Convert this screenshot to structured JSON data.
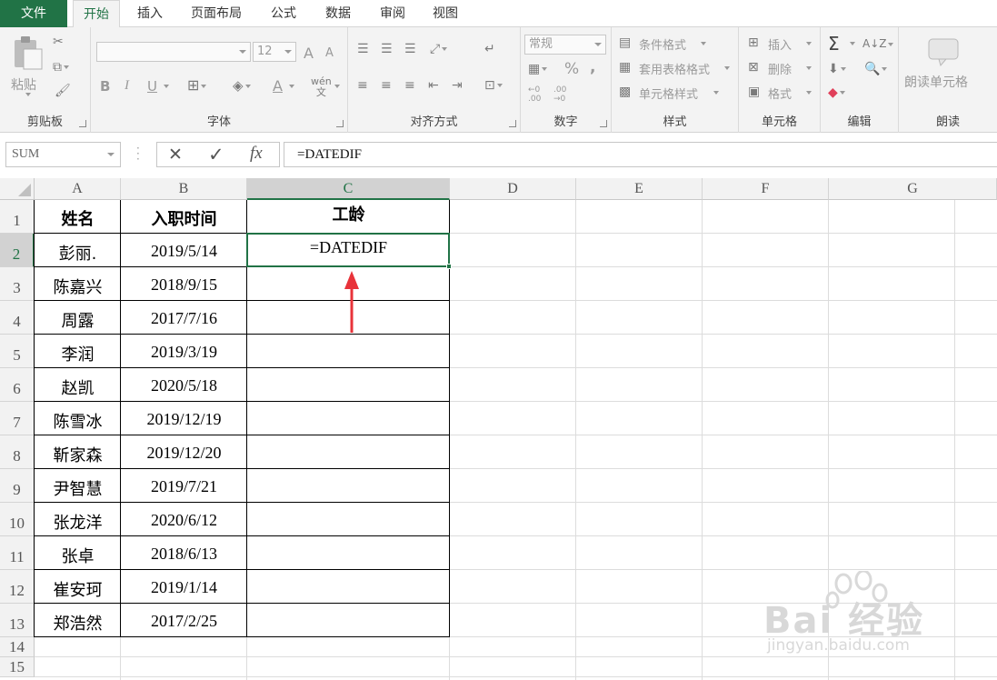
{
  "tabs": {
    "file": "文件",
    "items": [
      "开始",
      "插入",
      "页面布局",
      "公式",
      "数据",
      "审阅",
      "视图"
    ],
    "active": "开始"
  },
  "ribbon": {
    "clipboard": {
      "label": "剪贴板",
      "paste": "粘贴"
    },
    "font": {
      "label": "字体",
      "size": "12",
      "bold": "B",
      "italic": "I",
      "underline": "U",
      "font_a": "A",
      "grow": "A",
      "shrink": "A"
    },
    "alignment": {
      "label": "对齐方式"
    },
    "number": {
      "label": "数字",
      "format": "常规",
      "percent": "%",
      "comma": ",",
      "dec_more": "←0 .00",
      "dec_less": ".00 →0"
    },
    "styles": {
      "label": "样式",
      "conditional": "条件格式",
      "table": "套用表格格式",
      "cell_styles": "单元格样式"
    },
    "cells": {
      "label": "单元格",
      "insert": "插入",
      "delete": "删除",
      "format": "格式"
    },
    "editing": {
      "label": "编辑",
      "sigma": "Σ"
    },
    "read": {
      "label": "朗读",
      "read_cell": "朗读单元格"
    }
  },
  "formula_bar": {
    "name_box": "SUM",
    "cancel": "✕",
    "enter": "✓",
    "fx": "fx",
    "content": "=DATEDIF"
  },
  "sheet": {
    "columns": [
      "A",
      "B",
      "C",
      "D",
      "E",
      "F",
      "G"
    ],
    "rows": [
      "1",
      "2",
      "3",
      "4",
      "5",
      "6",
      "7",
      "8",
      "9",
      "10",
      "11",
      "12",
      "13",
      "14",
      "15"
    ],
    "header": {
      "name": "姓名",
      "date": "入职时间",
      "tenure": "工龄"
    },
    "data": [
      {
        "name": "彭丽.",
        "date": "2019/5/14",
        "tenure": "=DATEDIF"
      },
      {
        "name": "陈嘉兴",
        "date": "2018/9/15",
        "tenure": ""
      },
      {
        "name": "周露",
        "date": "2017/7/16",
        "tenure": ""
      },
      {
        "name": "李润",
        "date": "2019/3/19",
        "tenure": ""
      },
      {
        "name": "赵凯",
        "date": "2020/5/18",
        "tenure": ""
      },
      {
        "name": "陈雪冰",
        "date": "2019/12/19",
        "tenure": ""
      },
      {
        "name": "靳家森",
        "date": "2019/12/20",
        "tenure": ""
      },
      {
        "name": "尹智慧",
        "date": "2019/7/21",
        "tenure": ""
      },
      {
        "name": "张龙洋",
        "date": "2020/6/12",
        "tenure": ""
      },
      {
        "name": "张卓",
        "date": "2018/6/13",
        "tenure": ""
      },
      {
        "name": "崔安珂",
        "date": "2019/1/14",
        "tenure": ""
      },
      {
        "name": "郑浩然",
        "date": "2017/2/25",
        "tenure": ""
      }
    ],
    "active_cell": "C2",
    "accent_color": "#217346"
  },
  "annotation": {
    "arrow_color": "#e8333a"
  },
  "watermark": {
    "brand": "Bai 经验",
    "url": "jingyan.baidu.com"
  }
}
